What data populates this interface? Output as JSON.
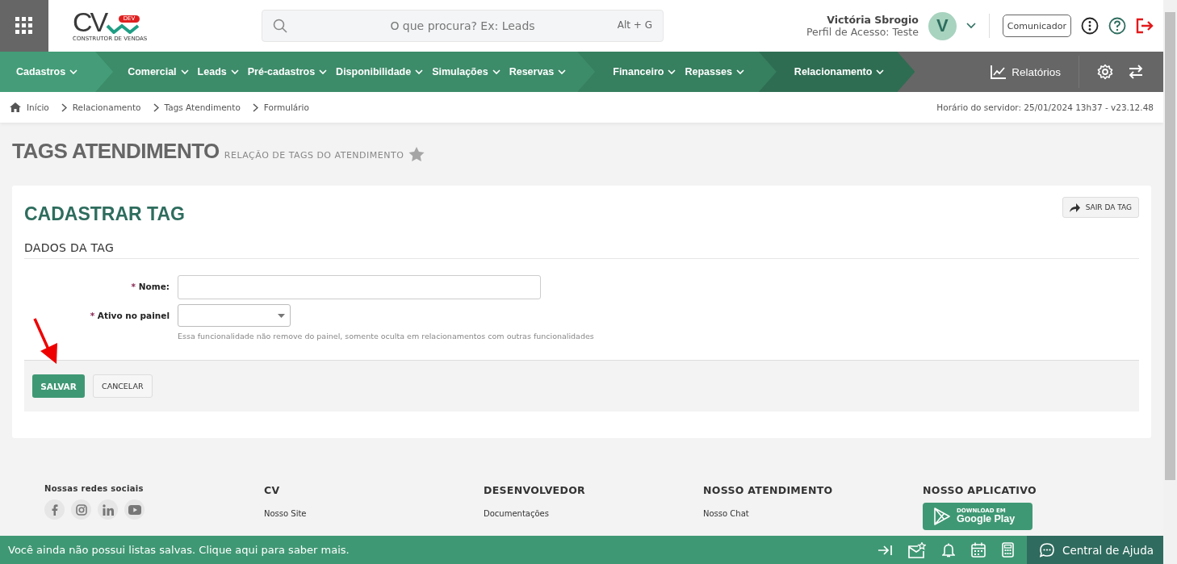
{
  "header": {
    "logo": {
      "text": "CV",
      "badge": "DEV",
      "tagline": "CONSTRUTOR DE VENDAS"
    },
    "search": {
      "placeholder": "O que procura? Ex: Leads",
      "shortcut": "Alt + G"
    },
    "user": {
      "name": "Victória Sbrogio",
      "profile": "Perfil de Acesso: Teste",
      "initial": "V"
    },
    "communicator_button": "Comunicador"
  },
  "nav": {
    "groups": [
      {
        "color": "#449d78",
        "items": [
          "Cadastros"
        ]
      },
      {
        "color": "#3c8b69",
        "items": [
          "Comercial",
          "Leads",
          "Pré-cadastros",
          "Disponibilidade",
          "Simulações",
          "Reservas"
        ]
      },
      {
        "color": "#367f5f",
        "items": [
          "Financeiro",
          "Repasses"
        ]
      },
      {
        "color": "#2e6d52",
        "items": [
          "Relacionamento"
        ]
      }
    ],
    "reports": "Relatórios"
  },
  "breadcrumb": [
    "Início",
    "Relacionamento",
    "Tags Atendimento",
    "Formulário"
  ],
  "server_time": "Horário do servidor: 25/01/2024 13h37 - v23.12.48",
  "page": {
    "title": "TAGS ATENDIMENTO",
    "subtitle": "RELAÇÃO DE TAGS DO ATENDIMENTO"
  },
  "form": {
    "title": "CADASTRAR TAG",
    "exit_button": "SAIR DA TAG",
    "section": "DADOS DA TAG",
    "fields": [
      {
        "kind": "text",
        "required_mark": "*",
        "label": "Nome:"
      },
      {
        "kind": "select",
        "required_mark": "*",
        "label": "Ativo no painel",
        "help": "Essa funcionalidade não remove do painel, somente oculta em relacionamentos com outras funcionalidades"
      }
    ],
    "buttons": [
      {
        "kind": "primary",
        "label": "SALVAR"
      },
      {
        "kind": "default",
        "label": "CANCELAR"
      }
    ]
  },
  "footer": {
    "columns": [
      {
        "kind": "social",
        "title": "Nossas redes sociais"
      },
      {
        "kind": "links",
        "title": "CV",
        "links": [
          "Nosso Site"
        ]
      },
      {
        "kind": "links",
        "title": "DESENVOLVEDOR",
        "links": [
          "Documentações"
        ]
      },
      {
        "kind": "links",
        "title": "NOSSO ATENDIMENTO",
        "links": [
          "Nosso Chat"
        ]
      },
      {
        "kind": "app",
        "title": "NOSSO APLICATIVO",
        "badge_small": "DOWNLOAD EM",
        "badge_big": "Google Play"
      }
    ]
  },
  "bottom_bar": {
    "message": "Você ainda não possui listas salvas. Clique aqui para saber mais.",
    "help": "Central de Ajuda"
  }
}
